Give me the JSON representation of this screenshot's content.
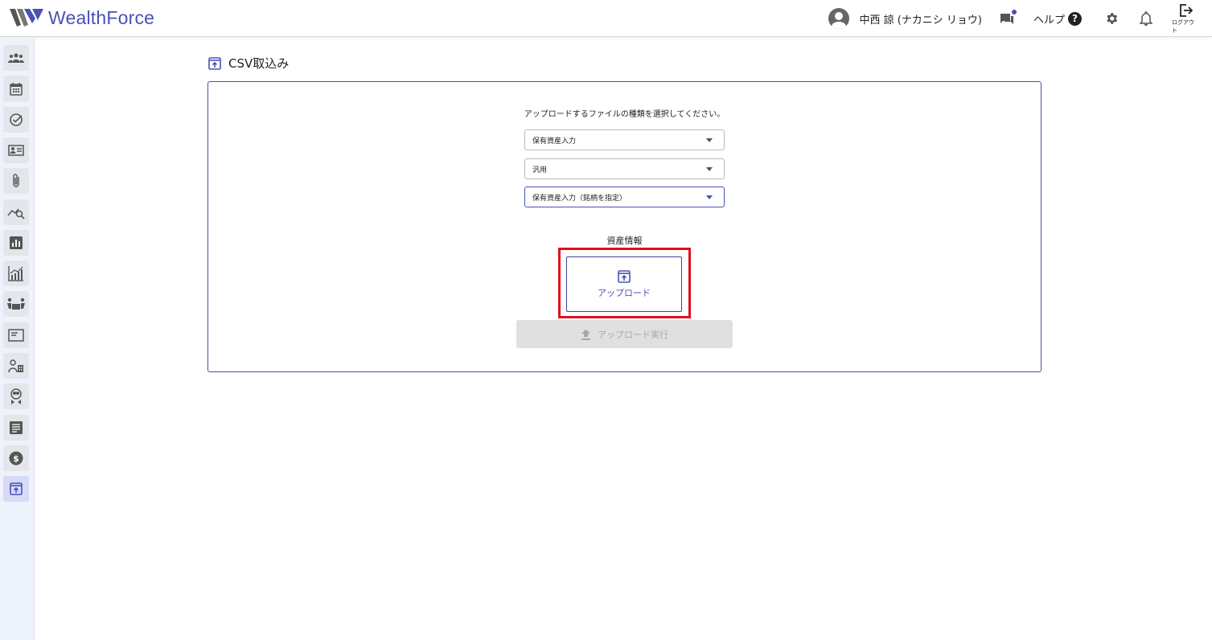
{
  "header": {
    "brand": "WealthForce",
    "user_name": "中西 諒 (ナカニシ リョウ)",
    "help_label": "ヘルプ",
    "help_icon_text": "?",
    "logout_label": "ログアウト"
  },
  "sidebar": {
    "items": [
      {
        "icon": "people-icon"
      },
      {
        "icon": "calendar-icon"
      },
      {
        "icon": "check-circle-icon"
      },
      {
        "icon": "contact-card-icon"
      },
      {
        "icon": "paperclip-icon"
      },
      {
        "icon": "trend-search-icon"
      },
      {
        "icon": "bar-chart-icon"
      },
      {
        "icon": "growth-chart-icon"
      },
      {
        "icon": "meeting-icon"
      },
      {
        "icon": "article-icon"
      },
      {
        "icon": "person-building-icon"
      },
      {
        "icon": "advisor-icon"
      },
      {
        "icon": "document-icon"
      },
      {
        "icon": "dollar-icon"
      },
      {
        "icon": "upload-icon",
        "active": true
      }
    ]
  },
  "page": {
    "title": "CSV取込み",
    "instruction": "アップロードするファイルの種類を選択してください。",
    "selects": [
      {
        "value": "保有資産入力"
      },
      {
        "value": "汎用"
      },
      {
        "value": "保有資産入力（銘柄を指定）"
      }
    ],
    "section_label": "資産情報",
    "upload_label": "アップロード",
    "execute_label": "アップロード実行"
  },
  "colors": {
    "accent": "#4a50b8",
    "highlight": "#e0101e",
    "disabled": "#e0e0e0"
  }
}
